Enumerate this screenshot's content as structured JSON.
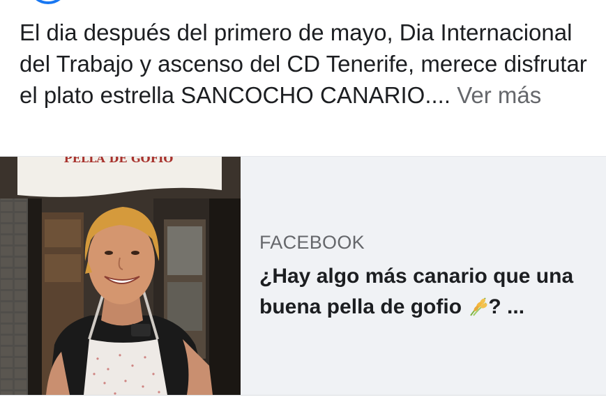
{
  "post": {
    "text": "El dia después del primero de mayo, Dia Internacional del Trabajo y ascenso del CD Tenerife, merece disfrutar el plato estrella SANCOCHO CANARIO.... ",
    "see_more": "Ver más"
  },
  "link_card": {
    "image_icon": "photo-woman-apron-icon",
    "source": "FACEBOOK",
    "title_before_emoji": "¿Hay algo más canario que una buena pella de gofio ",
    "emoji_icon": "sheaf-of-rice-icon",
    "title_after_emoji": "? ...",
    "image_banner_text": "PELLA DE GOFIO"
  },
  "colors": {
    "text_primary": "#1c1e21",
    "text_secondary": "#65676b",
    "card_background": "#f0f2f5",
    "brand_blue": "#1877f2"
  }
}
